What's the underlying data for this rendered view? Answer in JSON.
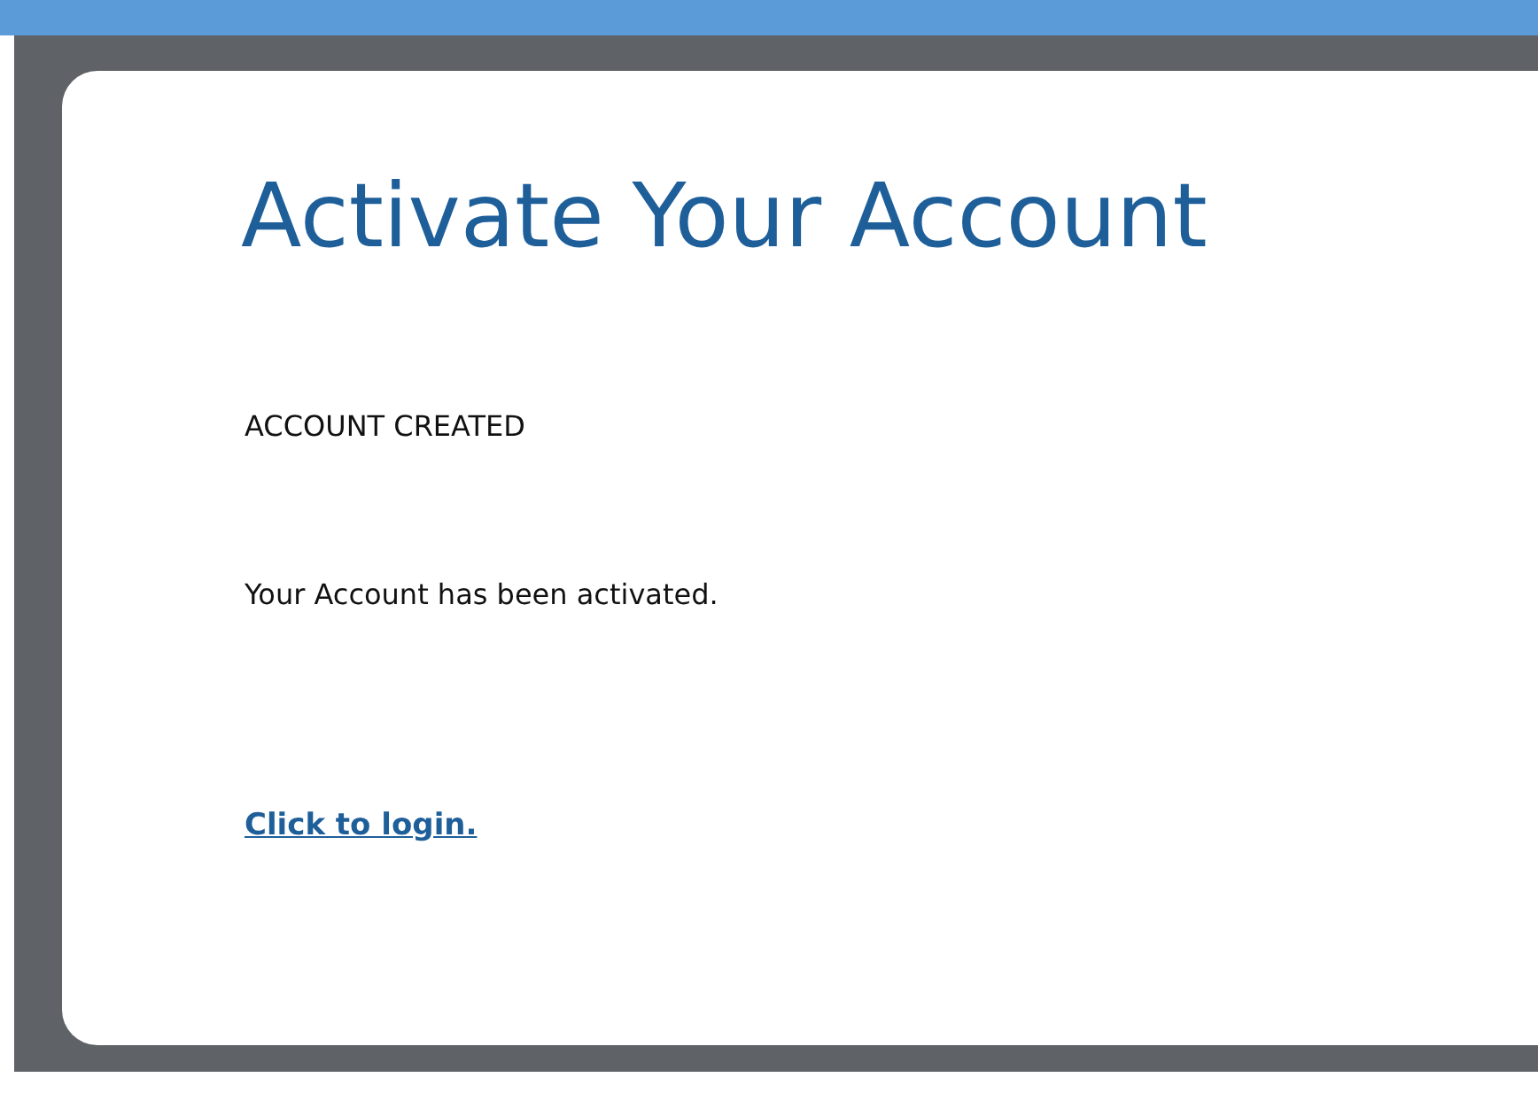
{
  "heading": "Activate Your Account",
  "status": "ACCOUNT CREATED",
  "message": "Your Account has been activated.",
  "login_link": "Click to login."
}
